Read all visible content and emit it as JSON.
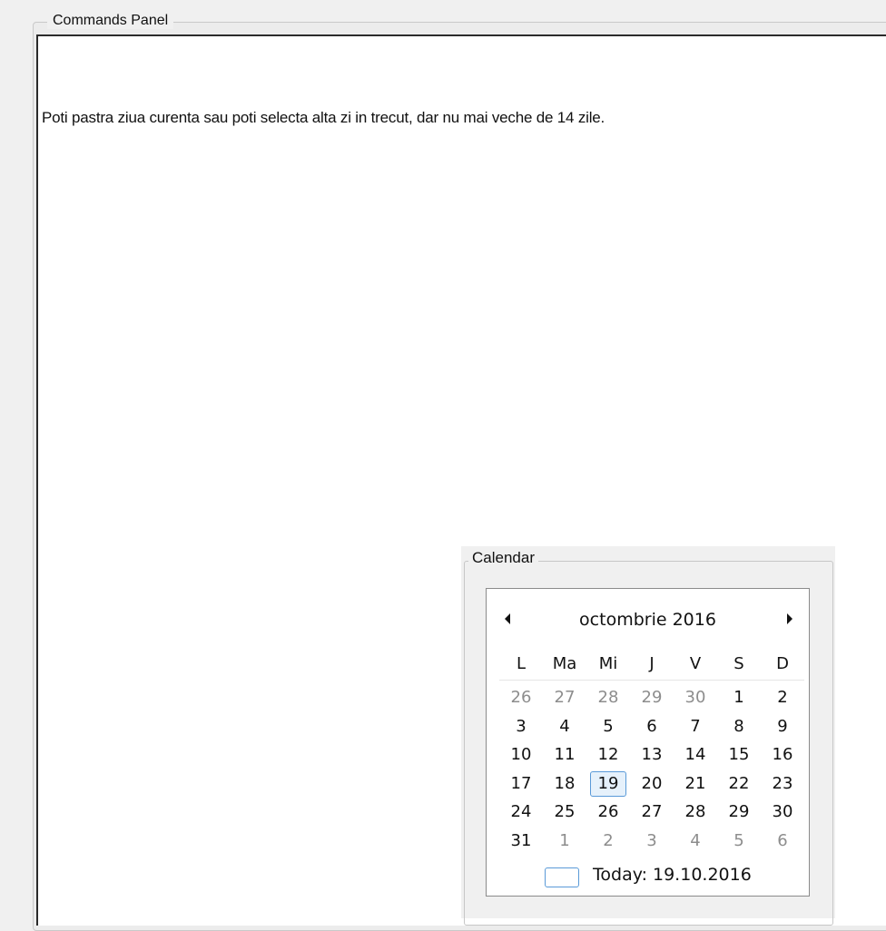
{
  "commands_panel": {
    "title": "Commands Panel",
    "message": "Poti pastra ziua curenta sau poti selecta alta zi in trecut, dar nu mai veche de 14 zile."
  },
  "calendar": {
    "group_title": "Calendar",
    "month_title": "octombrie 2016",
    "prev_icon": "left-arrow-icon",
    "next_icon": "right-arrow-icon",
    "day_names": [
      "L",
      "Ma",
      "Mi",
      "J",
      "V",
      "S",
      "D"
    ],
    "days": [
      {
        "label": "26",
        "other": true
      },
      {
        "label": "27",
        "other": true
      },
      {
        "label": "28",
        "other": true
      },
      {
        "label": "29",
        "other": true
      },
      {
        "label": "30",
        "other": true
      },
      {
        "label": "1",
        "other": false
      },
      {
        "label": "2",
        "other": false
      },
      {
        "label": "3",
        "other": false
      },
      {
        "label": "4",
        "other": false
      },
      {
        "label": "5",
        "other": false
      },
      {
        "label": "6",
        "other": false
      },
      {
        "label": "7",
        "other": false
      },
      {
        "label": "8",
        "other": false
      },
      {
        "label": "9",
        "other": false
      },
      {
        "label": "10",
        "other": false
      },
      {
        "label": "11",
        "other": false
      },
      {
        "label": "12",
        "other": false
      },
      {
        "label": "13",
        "other": false
      },
      {
        "label": "14",
        "other": false
      },
      {
        "label": "15",
        "other": false
      },
      {
        "label": "16",
        "other": false
      },
      {
        "label": "17",
        "other": false
      },
      {
        "label": "18",
        "other": false
      },
      {
        "label": "19",
        "other": false,
        "selected": true
      },
      {
        "label": "20",
        "other": false
      },
      {
        "label": "21",
        "other": false
      },
      {
        "label": "22",
        "other": false
      },
      {
        "label": "23",
        "other": false
      },
      {
        "label": "24",
        "other": false
      },
      {
        "label": "25",
        "other": false
      },
      {
        "label": "26",
        "other": false
      },
      {
        "label": "27",
        "other": false
      },
      {
        "label": "28",
        "other": false
      },
      {
        "label": "29",
        "other": false
      },
      {
        "label": "30",
        "other": false
      },
      {
        "label": "31",
        "other": false
      },
      {
        "label": "1",
        "other": true
      },
      {
        "label": "2",
        "other": true
      },
      {
        "label": "3",
        "other": true
      },
      {
        "label": "4",
        "other": true
      },
      {
        "label": "5",
        "other": true
      },
      {
        "label": "6",
        "other": true
      }
    ],
    "today_label": "Today: 19.10.2016",
    "colors": {
      "selection_border": "#5a9ad8",
      "other_month": "#8d8d8d"
    }
  }
}
